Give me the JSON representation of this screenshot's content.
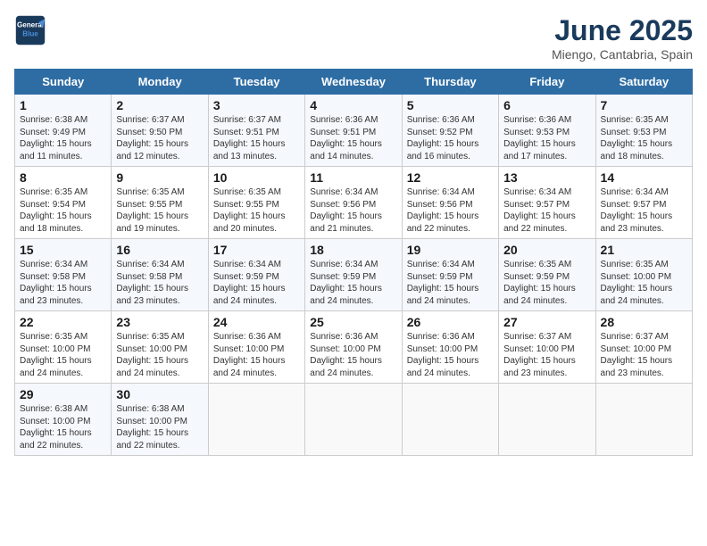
{
  "logo": {
    "line1": "General",
    "line2": "Blue"
  },
  "title": "June 2025",
  "subtitle": "Miengo, Cantabria, Spain",
  "days_of_week": [
    "Sunday",
    "Monday",
    "Tuesday",
    "Wednesday",
    "Thursday",
    "Friday",
    "Saturday"
  ],
  "weeks": [
    [
      {
        "day": "1",
        "info": "Sunrise: 6:38 AM\nSunset: 9:49 PM\nDaylight: 15 hours\nand 11 minutes."
      },
      {
        "day": "2",
        "info": "Sunrise: 6:37 AM\nSunset: 9:50 PM\nDaylight: 15 hours\nand 12 minutes."
      },
      {
        "day": "3",
        "info": "Sunrise: 6:37 AM\nSunset: 9:51 PM\nDaylight: 15 hours\nand 13 minutes."
      },
      {
        "day": "4",
        "info": "Sunrise: 6:36 AM\nSunset: 9:51 PM\nDaylight: 15 hours\nand 14 minutes."
      },
      {
        "day": "5",
        "info": "Sunrise: 6:36 AM\nSunset: 9:52 PM\nDaylight: 15 hours\nand 16 minutes."
      },
      {
        "day": "6",
        "info": "Sunrise: 6:36 AM\nSunset: 9:53 PM\nDaylight: 15 hours\nand 17 minutes."
      },
      {
        "day": "7",
        "info": "Sunrise: 6:35 AM\nSunset: 9:53 PM\nDaylight: 15 hours\nand 18 minutes."
      }
    ],
    [
      {
        "day": "8",
        "info": "Sunrise: 6:35 AM\nSunset: 9:54 PM\nDaylight: 15 hours\nand 18 minutes."
      },
      {
        "day": "9",
        "info": "Sunrise: 6:35 AM\nSunset: 9:55 PM\nDaylight: 15 hours\nand 19 minutes."
      },
      {
        "day": "10",
        "info": "Sunrise: 6:35 AM\nSunset: 9:55 PM\nDaylight: 15 hours\nand 20 minutes."
      },
      {
        "day": "11",
        "info": "Sunrise: 6:34 AM\nSunset: 9:56 PM\nDaylight: 15 hours\nand 21 minutes."
      },
      {
        "day": "12",
        "info": "Sunrise: 6:34 AM\nSunset: 9:56 PM\nDaylight: 15 hours\nand 22 minutes."
      },
      {
        "day": "13",
        "info": "Sunrise: 6:34 AM\nSunset: 9:57 PM\nDaylight: 15 hours\nand 22 minutes."
      },
      {
        "day": "14",
        "info": "Sunrise: 6:34 AM\nSunset: 9:57 PM\nDaylight: 15 hours\nand 23 minutes."
      }
    ],
    [
      {
        "day": "15",
        "info": "Sunrise: 6:34 AM\nSunset: 9:58 PM\nDaylight: 15 hours\nand 23 minutes."
      },
      {
        "day": "16",
        "info": "Sunrise: 6:34 AM\nSunset: 9:58 PM\nDaylight: 15 hours\nand 23 minutes."
      },
      {
        "day": "17",
        "info": "Sunrise: 6:34 AM\nSunset: 9:59 PM\nDaylight: 15 hours\nand 24 minutes."
      },
      {
        "day": "18",
        "info": "Sunrise: 6:34 AM\nSunset: 9:59 PM\nDaylight: 15 hours\nand 24 minutes."
      },
      {
        "day": "19",
        "info": "Sunrise: 6:34 AM\nSunset: 9:59 PM\nDaylight: 15 hours\nand 24 minutes."
      },
      {
        "day": "20",
        "info": "Sunrise: 6:35 AM\nSunset: 9:59 PM\nDaylight: 15 hours\nand 24 minutes."
      },
      {
        "day": "21",
        "info": "Sunrise: 6:35 AM\nSunset: 10:00 PM\nDaylight: 15 hours\nand 24 minutes."
      }
    ],
    [
      {
        "day": "22",
        "info": "Sunrise: 6:35 AM\nSunset: 10:00 PM\nDaylight: 15 hours\nand 24 minutes."
      },
      {
        "day": "23",
        "info": "Sunrise: 6:35 AM\nSunset: 10:00 PM\nDaylight: 15 hours\nand 24 minutes."
      },
      {
        "day": "24",
        "info": "Sunrise: 6:36 AM\nSunset: 10:00 PM\nDaylight: 15 hours\nand 24 minutes."
      },
      {
        "day": "25",
        "info": "Sunrise: 6:36 AM\nSunset: 10:00 PM\nDaylight: 15 hours\nand 24 minutes."
      },
      {
        "day": "26",
        "info": "Sunrise: 6:36 AM\nSunset: 10:00 PM\nDaylight: 15 hours\nand 24 minutes."
      },
      {
        "day": "27",
        "info": "Sunrise: 6:37 AM\nSunset: 10:00 PM\nDaylight: 15 hours\nand 23 minutes."
      },
      {
        "day": "28",
        "info": "Sunrise: 6:37 AM\nSunset: 10:00 PM\nDaylight: 15 hours\nand 23 minutes."
      }
    ],
    [
      {
        "day": "29",
        "info": "Sunrise: 6:38 AM\nSunset: 10:00 PM\nDaylight: 15 hours\nand 22 minutes."
      },
      {
        "day": "30",
        "info": "Sunrise: 6:38 AM\nSunset: 10:00 PM\nDaylight: 15 hours\nand 22 minutes."
      },
      {
        "day": "",
        "info": ""
      },
      {
        "day": "",
        "info": ""
      },
      {
        "day": "",
        "info": ""
      },
      {
        "day": "",
        "info": ""
      },
      {
        "day": "",
        "info": ""
      }
    ]
  ]
}
